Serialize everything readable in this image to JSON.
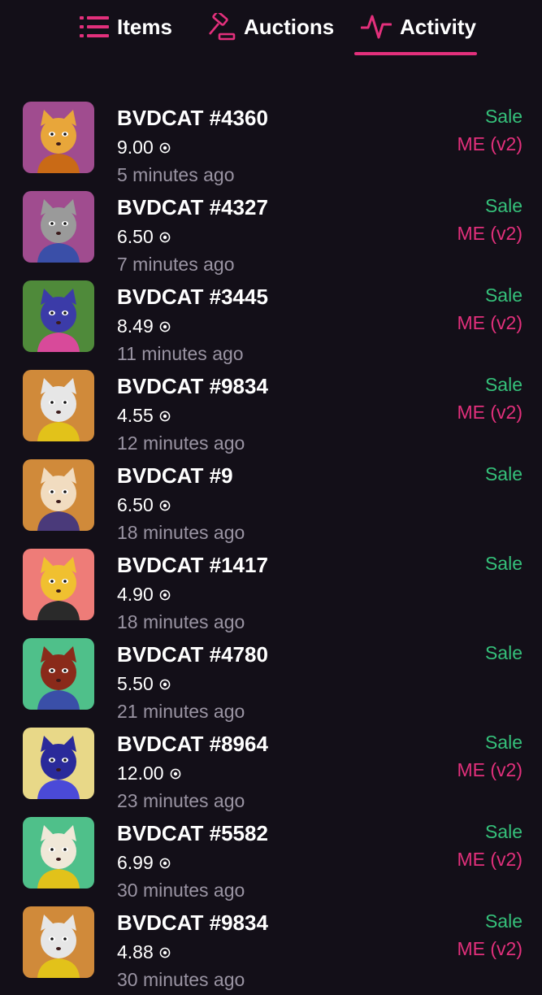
{
  "tabs": [
    {
      "label": "Items",
      "icon": "list-icon"
    },
    {
      "label": "Auctions",
      "icon": "gavel-icon"
    },
    {
      "label": "Activity",
      "icon": "pulse-icon"
    }
  ],
  "colors": {
    "background": "#130f18",
    "accent": "#e3307c",
    "sale": "#35c07a",
    "muted": "#9a94a3"
  },
  "activity": [
    {
      "name": "BVDCAT #4360",
      "price": "9.00",
      "time": "5 minutes ago",
      "type": "Sale",
      "market": "ME (v2)",
      "bg": "#a04c8f",
      "fur": "#e8a63a",
      "accent": "#c96a16"
    },
    {
      "name": "BVDCAT #4327",
      "price": "6.50",
      "time": "7 minutes ago",
      "type": "Sale",
      "market": "ME (v2)",
      "bg": "#a04c8f",
      "fur": "#9a9a9a",
      "accent": "#3a4fa8"
    },
    {
      "name": "BVDCAT #3445",
      "price": "8.49",
      "time": "11 minutes ago",
      "type": "Sale",
      "market": "ME (v2)",
      "bg": "#4f8a3a",
      "fur": "#3b3ba8",
      "accent": "#d84a9a"
    },
    {
      "name": "BVDCAT #9834",
      "price": "4.55",
      "time": "12 minutes ago",
      "type": "Sale",
      "market": "ME (v2)",
      "bg": "#d08a3a",
      "fur": "#e6e6e6",
      "accent": "#e2c21a"
    },
    {
      "name": "BVDCAT #9",
      "price": "6.50",
      "time": "18 minutes ago",
      "type": "Sale",
      "market": "",
      "bg": "#d08a3a",
      "fur": "#f1dcc0",
      "accent": "#4a3a7a"
    },
    {
      "name": "BVDCAT #1417",
      "price": "4.90",
      "time": "18 minutes ago",
      "type": "Sale",
      "market": "",
      "bg": "#ee7c78",
      "fur": "#f0c030",
      "accent": "#2a2a2a"
    },
    {
      "name": "BVDCAT #4780",
      "price": "5.50",
      "time": "21 minutes ago",
      "type": "Sale",
      "market": "",
      "bg": "#4fc08a",
      "fur": "#8a2a1a",
      "accent": "#3a4fa8"
    },
    {
      "name": "BVDCAT #8964",
      "price": "12.00",
      "time": "23 minutes ago",
      "type": "Sale",
      "market": "ME (v2)",
      "bg": "#e8d888",
      "fur": "#2a2a9a",
      "accent": "#4a4ad8"
    },
    {
      "name": "BVDCAT #5582",
      "price": "6.99",
      "time": "30 minutes ago",
      "type": "Sale",
      "market": "ME (v2)",
      "bg": "#4fc08a",
      "fur": "#f0e8d8",
      "accent": "#e2c21a"
    },
    {
      "name": "BVDCAT #9834",
      "price": "4.88",
      "time": "30 minutes ago",
      "type": "Sale",
      "market": "ME (v2)",
      "bg": "#d08a3a",
      "fur": "#e6e6e6",
      "accent": "#e2c21a"
    }
  ]
}
